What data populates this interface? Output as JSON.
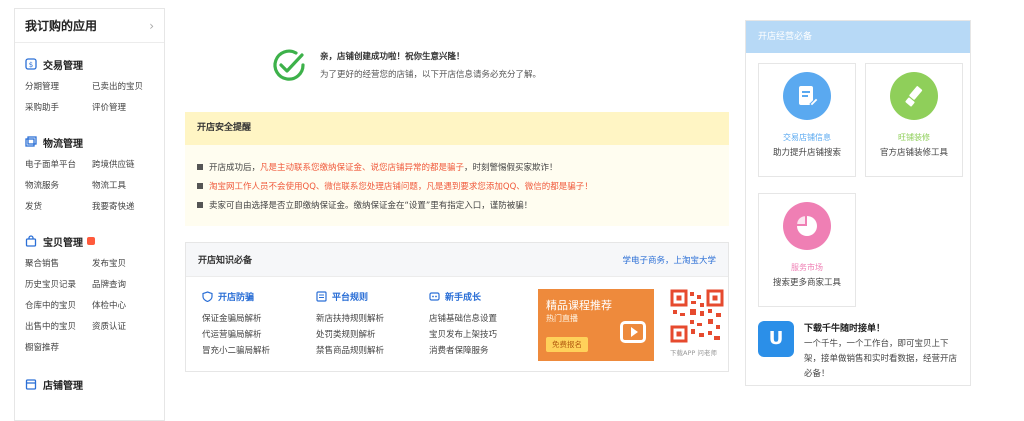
{
  "sidebar": {
    "title": "我订购的应用",
    "sections": [
      {
        "title": "交易管理",
        "links": [
          "分期管理",
          "已卖出的宝贝",
          "采购助手",
          "评价管理"
        ]
      },
      {
        "title": "物流管理",
        "links": [
          "电子面单平台",
          "跨境供应链",
          "物流服务",
          "物流工具",
          "发货",
          "我要寄快递"
        ]
      },
      {
        "title": "宝贝管理",
        "links": [
          "聚合销售",
          "发布宝贝",
          "历史宝贝记录",
          "品牌查询",
          "仓库中的宝贝",
          "体检中心",
          "出售中的宝贝",
          "资质认证",
          "橱窗推荐"
        ]
      },
      {
        "title": "店铺管理",
        "links": []
      }
    ]
  },
  "success": {
    "line1": "亲，店铺创建成功啦！祝你生意兴隆！",
    "line2": "为了更好的经营您的店铺，以下开店信息请务必充分了解。"
  },
  "safety": {
    "title": "开店安全提醒",
    "items": [
      {
        "a": "开店成功后，",
        "b": "凡是主动联系您缴纳保证金、说您店铺异常的都是骗子",
        "c": "，时刻警惕假买家欺诈！"
      },
      {
        "a": "",
        "b": "淘宝网工作人员不会使用QQ、微信联系您处理店铺问题",
        "c": "，凡是遇到要求您添加QQ、微信的都是骗子！"
      },
      {
        "a": "卖家可自由选择是否立即缴纳保证金。缴纳保证金在“设置”里有指定入口，谨防被骗！",
        "b": "",
        "c": ""
      }
    ]
  },
  "knowledge": {
    "title": "开店知识必备",
    "link": "学电子商务，上淘宝大学",
    "columns": [
      {
        "title": "开店防骗",
        "links": [
          "保证金骗局解析",
          "代运营骗局解析",
          "冒充小二骗局解析"
        ]
      },
      {
        "title": "平台规则",
        "links": [
          "新店扶持规则解析",
          "处罚类规则解析",
          "禁售商品规则解析"
        ]
      },
      {
        "title": "新手成长",
        "links": [
          "店铺基础信息设置",
          "宝贝发布上架技巧",
          "消费者保障服务"
        ]
      }
    ],
    "promo": {
      "title": "精品课程推荐",
      "sub": "热门直播",
      "btn": "免费报名"
    },
    "qr_caption": "下载APP 问老师"
  },
  "right_panel": {
    "title": "开店经营必备",
    "cards": [
      {
        "title": "交易店铺信息",
        "desc": "助力提升店铺搜索",
        "color": "#5aa9f0",
        "icon": "edit-doc-icon"
      },
      {
        "title": "旺铺装修",
        "desc": "官方店铺装修工具",
        "color": "#8fcf5a",
        "icon": "brush-icon"
      },
      {
        "title": "服务市场",
        "desc": "搜索更多商家工具",
        "color": "#ef7fb4",
        "icon": "pie-chart-icon"
      }
    ],
    "download": {
      "title": "下载千牛随时接单！",
      "desc": "一个千牛，一个工作台，即可宝贝上下架，接单做销售和实时看数据，经营开店必备！"
    }
  },
  "colors": {
    "accent_blue": "#2b6fd6",
    "warning_red": "#f05a3c",
    "success_green": "#3db14a",
    "header_blue": "#b7d9f6"
  }
}
